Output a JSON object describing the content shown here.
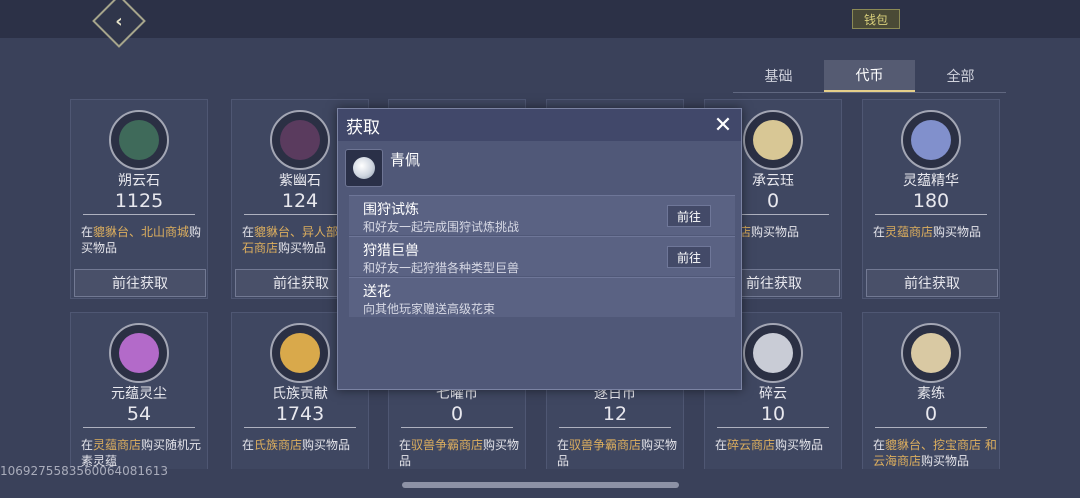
{
  "topbar": {
    "back_icon": "chevron-left-icon",
    "wallet_label": "钱包"
  },
  "tabs": [
    {
      "label": "基础",
      "active": false
    },
    {
      "label": "代币",
      "active": true
    },
    {
      "label": "全部",
      "active": false
    }
  ],
  "cards": [
    {
      "name": "朔云石",
      "count": "1125",
      "desc_pre": "在",
      "desc_hl": "貔貅台、北山商城",
      "desc_post": "购买物品",
      "button": "前往获取",
      "icon_color": "#3f6a5a"
    },
    {
      "name": "紫幽石",
      "count": "124",
      "desc_pre": "在",
      "desc_hl": "貔貅台、异人部 紫幽石商店",
      "desc_post": "购买物品",
      "button": "前往获取",
      "icon_color": "#5a3b5e"
    },
    {
      "name": "",
      "count": "",
      "desc_pre": "",
      "desc_hl": "",
      "desc_post": "",
      "button": "",
      "icon_color": "#4a5068"
    },
    {
      "name": "",
      "count": "",
      "desc_pre": "",
      "desc_hl": "",
      "desc_post": "",
      "button": "",
      "icon_color": "#4a5068"
    },
    {
      "name": "承云珏",
      "count": "0",
      "desc_pre": "",
      "desc_hl": "镜商店",
      "desc_post": "购买物品",
      "button": "前往获取",
      "icon_color": "#d8c795"
    },
    {
      "name": "灵蕴精华",
      "count": "180",
      "desc_pre": "在",
      "desc_hl": "灵蕴商店",
      "desc_post": "购买物品",
      "button": "前往获取",
      "icon_color": "#8190cc"
    },
    {
      "name": "元蕴灵尘",
      "count": "54",
      "desc_pre": "在",
      "desc_hl": "灵蕴商店",
      "desc_post": "购买随机元素灵蕴",
      "button": "",
      "icon_color": "#b36ac9"
    },
    {
      "name": "氏族贡献",
      "count": "1743",
      "desc_pre": "在",
      "desc_hl": "氏族商店",
      "desc_post": "购买物品",
      "button": "",
      "icon_color": "#d9a94b"
    },
    {
      "name": "七曜币",
      "count": "0",
      "desc_pre": "在",
      "desc_hl": "驭兽争霸商店",
      "desc_post": "购买物品",
      "button": "",
      "icon_color": "#6f7fa0"
    },
    {
      "name": "逐日币",
      "count": "12",
      "desc_pre": "在",
      "desc_hl": "驭兽争霸商店",
      "desc_post": "购买物品",
      "button": "",
      "icon_color": "#9c8a60"
    },
    {
      "name": "碎云",
      "count": "10",
      "desc_pre": "在",
      "desc_hl": "碎云商店",
      "desc_post": "购买物品",
      "button": "",
      "icon_color": "#c9ccd6"
    },
    {
      "name": "素练",
      "count": "0",
      "desc_pre": "在",
      "desc_hl": "貔貅台、挖宝商店 和云海商店",
      "desc_post": "购买物品",
      "button": "",
      "icon_color": "#d9c9a3"
    }
  ],
  "modal": {
    "title": "获取",
    "close_icon": "close-icon",
    "item_name": "青佩",
    "sources": [
      {
        "title": "围狩试炼",
        "desc": "和好友一起完成围狩试炼挑战",
        "button": "前往"
      },
      {
        "title": "狩猎巨兽",
        "desc": "和好友一起狩猎各种类型巨兽",
        "button": "前往"
      },
      {
        "title": "送花",
        "desc": "向其他玩家赠送高级花束",
        "button": ""
      }
    ]
  },
  "watermark": "1069275583560064081613"
}
